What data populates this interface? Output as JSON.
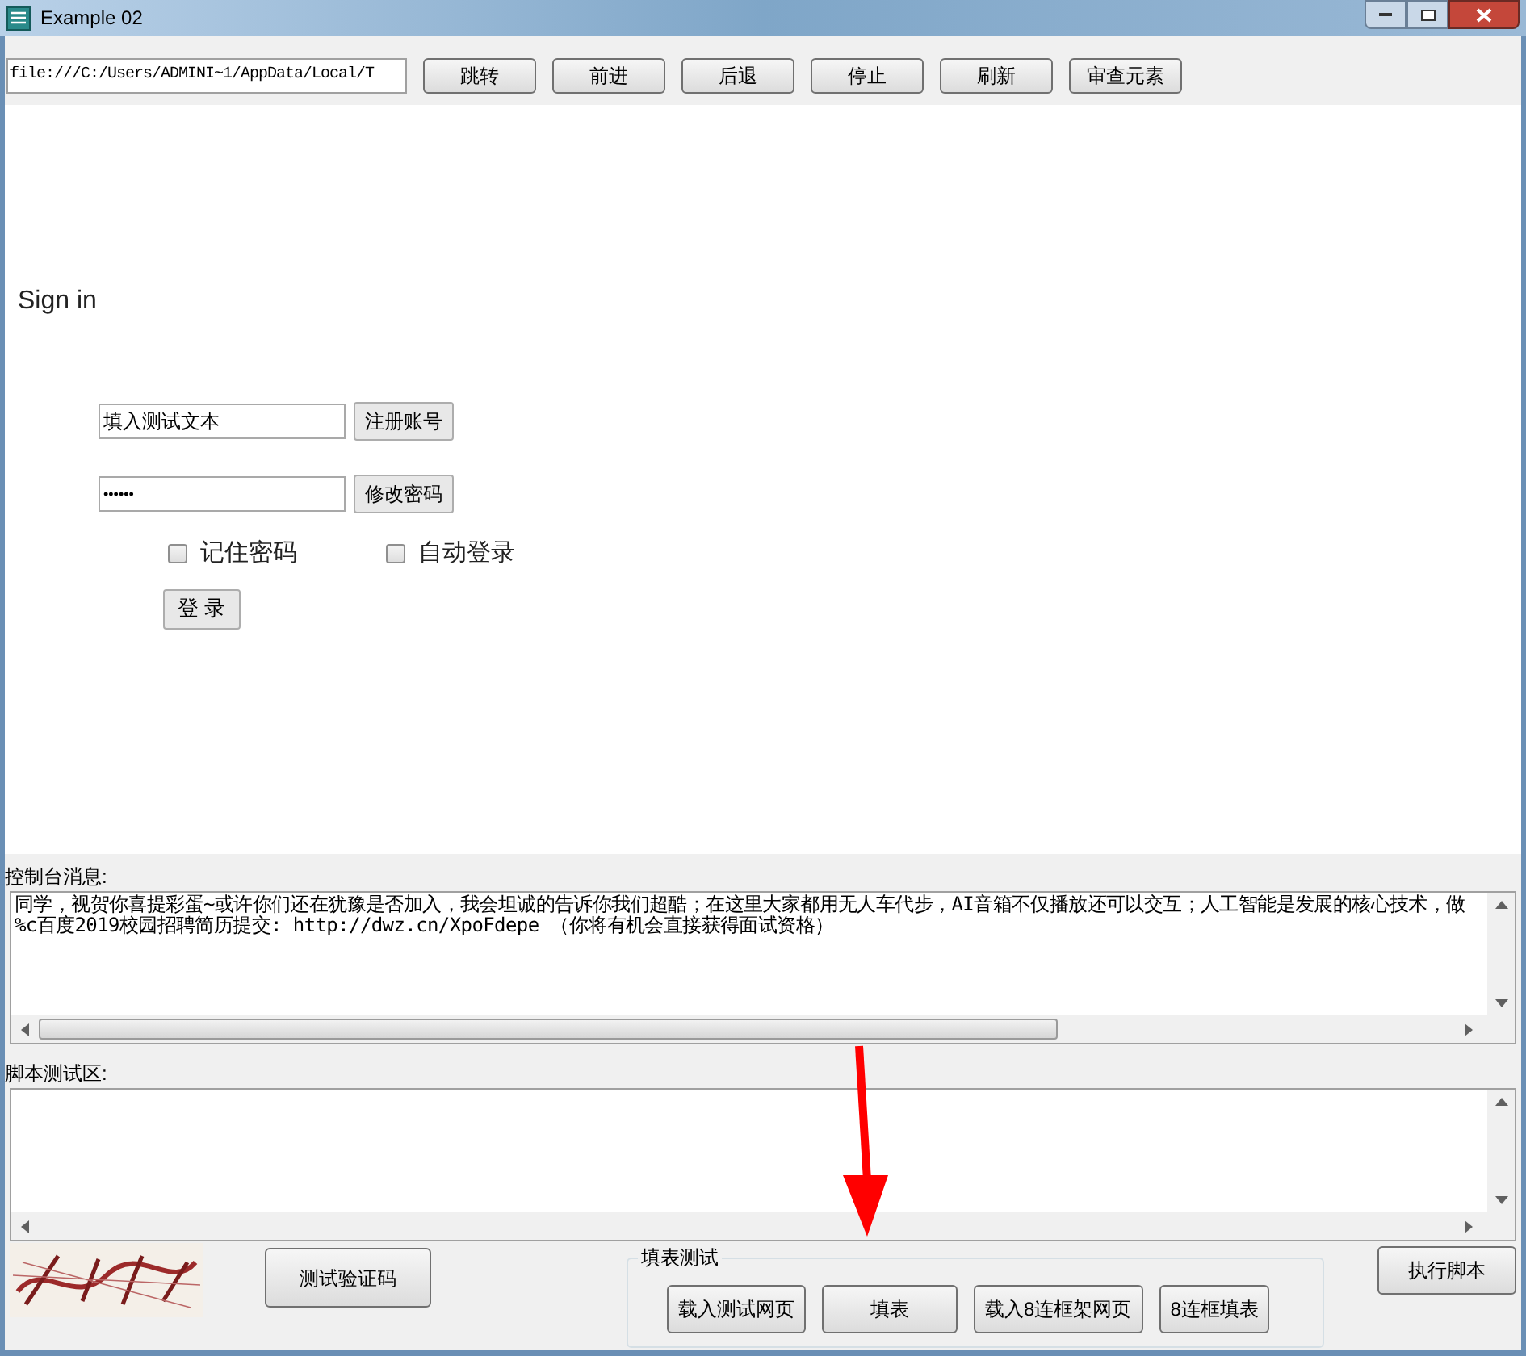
{
  "window": {
    "title": "Example 02"
  },
  "toolbar": {
    "url": "file:///C:/Users/ADMINI~1/AppData/Local/T",
    "buttons": [
      "跳转",
      "前进",
      "后退",
      "停止",
      "刷新",
      "审查元素"
    ]
  },
  "page": {
    "heading": "Sign in",
    "username": {
      "value": "填入测试文本"
    },
    "register_button": "注册账号",
    "password": {
      "value": "••••••"
    },
    "change_password_button": "修改密码",
    "checkboxes": [
      {
        "label": "记住密码",
        "checked": false
      },
      {
        "label": "自动登录",
        "checked": false
      }
    ],
    "login_button": "登 录"
  },
  "console": {
    "label": "控制台消息:",
    "lines": [
      "同学，视贺你喜提彩蛋~或许你们还在犹豫是否加入，我会坦诚的告诉你我们超酷；在这里大家都用无人车代步，AI音箱不仅播放还可以交互；人工智能是发展的核心技术，做",
      "%c百度2019校园招聘简历提交: http://dwz.cn/XpoFdepe （你将有机会直接获得面试资格）"
    ]
  },
  "script": {
    "label": "脚本测试区:"
  },
  "captcha_button": "测试验证码",
  "fill_test": {
    "title": "填表测试",
    "buttons": [
      "载入测试网页",
      "填表",
      "载入8连框架网页",
      "8连框填表"
    ]
  },
  "run_button": "执行脚本"
}
